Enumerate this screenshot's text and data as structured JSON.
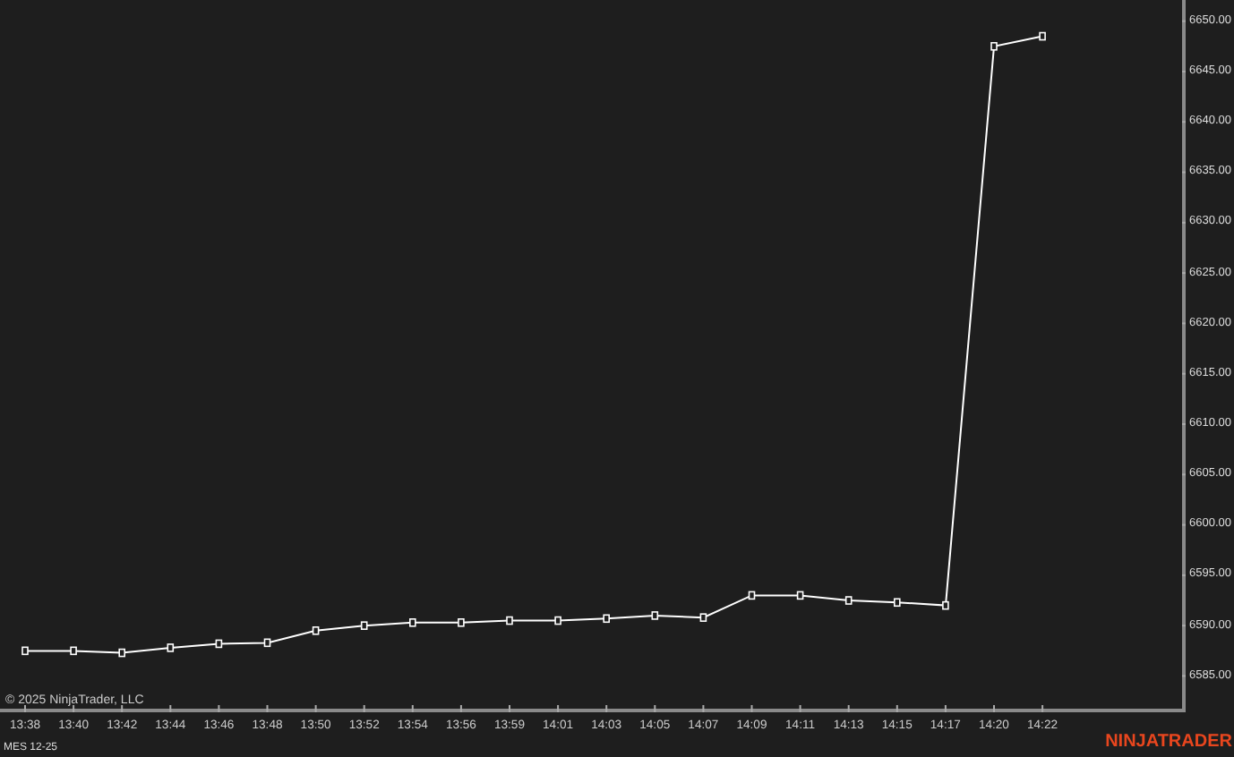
{
  "chart": {
    "copyright": "© 2025 NinjaTrader, LLC",
    "chart_data": {
      "type": "line",
      "categories": [
        "13:38",
        "13:40",
        "13:42",
        "13:44",
        "13:46",
        "13:48",
        "13:50",
        "13:52",
        "13:54",
        "13:56",
        "13:59",
        "14:01",
        "14:03",
        "14:05",
        "14:07",
        "14:09",
        "14:11",
        "14:13",
        "14:15",
        "14:17",
        "14:20",
        "14:22"
      ],
      "series": [
        {
          "name": "MES 12-25",
          "color": "#ffffff",
          "marker": "square",
          "values": [
            6587.5,
            6587.5,
            6587.3,
            6587.8,
            6588.2,
            6588.3,
            6589.5,
            6590,
            6590.3,
            6590.3,
            6590.5,
            6590.5,
            6590.7,
            6591,
            6590.8,
            6593,
            6593,
            6592.5,
            6592.3,
            6592,
            6647.5,
            6648.5
          ]
        }
      ],
      "ylim": [
        6581.4,
        6652.1
      ],
      "yticks": [
        {
          "value": 6650,
          "label": "6650.00"
        },
        {
          "value": 6645,
          "label": "6645.00"
        },
        {
          "value": 6640,
          "label": "6640.00"
        },
        {
          "value": 6635,
          "label": "6635.00"
        },
        {
          "value": 6630,
          "label": "6630.00"
        },
        {
          "value": 6625,
          "label": "6625.00"
        },
        {
          "value": 6620,
          "label": "6620.00"
        },
        {
          "value": 6615,
          "label": "6615.00"
        },
        {
          "value": 6610,
          "label": "6610.00"
        },
        {
          "value": 6605,
          "label": "6605.00"
        },
        {
          "value": 6600,
          "label": "6600.00"
        },
        {
          "value": 6595,
          "label": "6595.00"
        },
        {
          "value": 6590,
          "label": "6590.00"
        },
        {
          "value": 6585,
          "label": "6585.00"
        }
      ]
    }
  },
  "footer": {
    "logo": "NINJATRADER"
  }
}
